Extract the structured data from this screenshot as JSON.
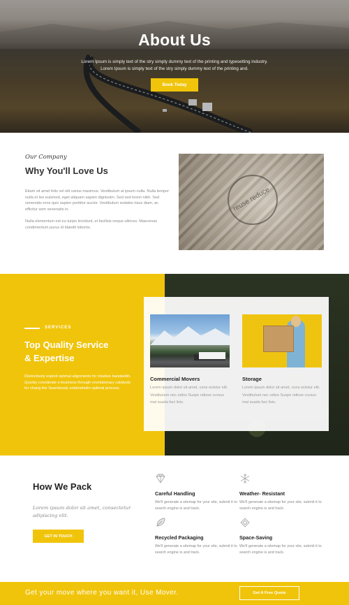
{
  "hero": {
    "title": "About Us",
    "subtitle_line1": "Lorem Ipsum is simply text of the stry simply dummy text of the printing and typesetting industry.",
    "subtitle_line2": "Lorem Ipsum is simply text of the stry simply dummy text of the printing and.",
    "button": "Book Today"
  },
  "company": {
    "eyebrow": "Our Company",
    "title": "Why You'll Love Us",
    "paragraph1": "Etiam sit amet felis vel elit varius maximus. Vestibulum at ipsum nulla. Nulla tempor nulla et leo euismod, eget aliquam sapien dignissim. Sed sed lorem nibh. Sed venenatis eros quis sapien porttitor auctor. Vestibulum sodales risus diam, ac efficitur sem venenatis in.",
    "paragraph2": "Nulla elementum est eu turpis tincidunt, et facilisis neque ultrices. Maecenas condimentum purus id blandit lobortis.",
    "image_text": "reuse reduce"
  },
  "services": {
    "label": "SERVICES",
    "title_line1": "Top Quality Service",
    "title_line2": "& Expertise",
    "description": "Distinctively exploit optimal alignments for intuitive bandwidth. Quickly coordinate e-business through revolutionary catalysts for chang the Seamlessly underwhelm optimal process.",
    "cards": [
      {
        "title": "Commercial Movers",
        "text": "Lorem ipsum dolor sit amet, cons ectetur elit. Vestibulum nec odios Suspe ndisse cursus mal suada faci lisis."
      },
      {
        "title": "Storage",
        "text": "Lorem ipsum dolor sit amet, cons ectetur elit. Vestibulum nec odios Suspe ndisse cursus mal suada faci lisis."
      }
    ]
  },
  "pack": {
    "title": "How We Pack",
    "quote": "Lorem ipsum dolor sit amet, consectetur adipiscing elit.",
    "button": "GET IN TOUCH",
    "features": [
      {
        "icon": "diamond-icon",
        "title": "Careful Handling",
        "text": "We'll generate a sitemap for your site, submit it to search engine is and track."
      },
      {
        "icon": "snowflake-icon",
        "title": "Weather- Resistant",
        "text": "We'll generate a sitemap for your site, submit it to search engine is and track."
      },
      {
        "icon": "leaf-icon",
        "title": "Recycled Packaging",
        "text": "We'll generate a sitemap for your site, submit it to search engine is and track."
      },
      {
        "icon": "diamond-outline-icon",
        "title": "Space-Saving",
        "text": "We'll generate a sitemap for your site, submit it to search engine is and track."
      }
    ]
  },
  "cta": {
    "text": "Get your move where you want it, Use Mover.",
    "button": "Get A Free Quote"
  },
  "colors": {
    "accent": "#f0c40a",
    "dark_text": "#222222",
    "muted_text": "#8a8a8a"
  }
}
